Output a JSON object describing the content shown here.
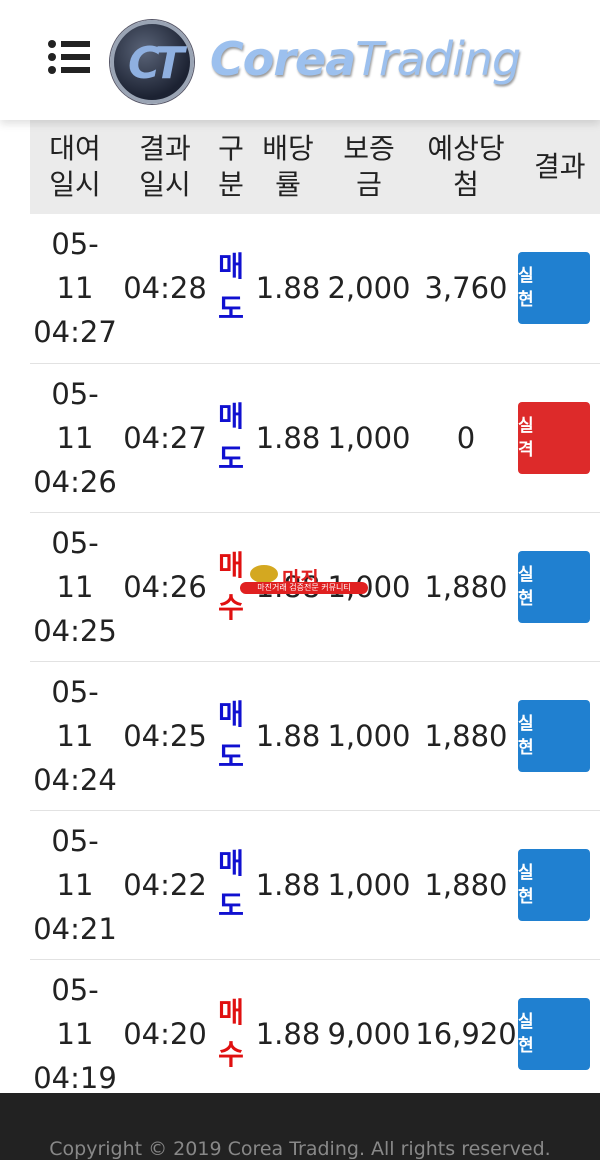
{
  "header": {
    "logo_mark": "CT",
    "logo_text_a": "Corea",
    "logo_text_b": "Trading"
  },
  "table": {
    "headers": [
      [
        "대여",
        "일시"
      ],
      [
        "결과",
        "일시"
      ],
      [
        "구",
        "분"
      ],
      [
        "배당",
        "률"
      ],
      [
        "보증",
        "금"
      ],
      [
        "예상당",
        "첨"
      ],
      [
        "결과",
        ""
      ]
    ],
    "rows": [
      {
        "date": "05-",
        "date2": "11",
        "time": "04:27",
        "result_time": "04:28",
        "type": [
          "매",
          "도"
        ],
        "type_kind": "sell",
        "rate": "1.88",
        "deposit": "2,000",
        "expected": "3,760",
        "result": [
          "실",
          "현"
        ],
        "result_kind": "win"
      },
      {
        "date": "05-",
        "date2": "11",
        "time": "04:26",
        "result_time": "04:27",
        "type": [
          "매",
          "도"
        ],
        "type_kind": "sell",
        "rate": "1.88",
        "deposit": "1,000",
        "expected": "0",
        "result": [
          "실",
          "격"
        ],
        "result_kind": "lose"
      },
      {
        "date": "05-",
        "date2": "11",
        "time": "04:25",
        "result_time": "04:26",
        "type": [
          "매",
          "수"
        ],
        "type_kind": "buy",
        "rate": "1.88",
        "deposit": "1,000",
        "expected": "1,880",
        "result": [
          "실",
          "현"
        ],
        "result_kind": "win"
      },
      {
        "date": "05-",
        "date2": "11",
        "time": "04:24",
        "result_time": "04:25",
        "type": [
          "매",
          "도"
        ],
        "type_kind": "sell",
        "rate": "1.88",
        "deposit": "1,000",
        "expected": "1,880",
        "result": [
          "실",
          "현"
        ],
        "result_kind": "win"
      },
      {
        "date": "05-",
        "date2": "11",
        "time": "04:21",
        "result_time": "04:22",
        "type": [
          "매",
          "도"
        ],
        "type_kind": "sell",
        "rate": "1.88",
        "deposit": "1,000",
        "expected": "1,880",
        "result": [
          "실",
          "현"
        ],
        "result_kind": "win"
      },
      {
        "date": "05-",
        "date2": "11",
        "time": "04:19",
        "result_time": "04:20",
        "type": [
          "매",
          "수"
        ],
        "type_kind": "buy",
        "rate": "1.88",
        "deposit": "9,000",
        "expected": "16,920",
        "result": [
          "실",
          "현"
        ],
        "result_kind": "win"
      }
    ]
  },
  "colors": {
    "sell": "#1010d0",
    "buy": "#e01010",
    "win": "#2080d0",
    "lose": "#dd2a2a"
  },
  "watermark": {
    "title": "마진",
    "subtitle": "마진거래 검증전문 커뮤니티"
  },
  "footer": {
    "copyright": "Copyright © 2019 Corea Trading. All rights reserved."
  }
}
